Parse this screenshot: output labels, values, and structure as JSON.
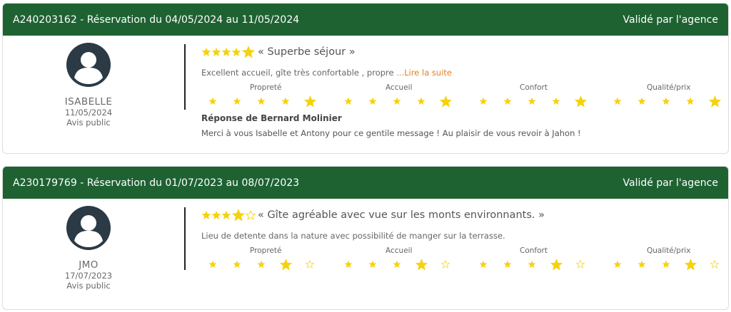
{
  "colors": {
    "header_bg": "#1e6232",
    "star": "#f5d20b",
    "star_empty": "#f5d20b",
    "link": "#e67e22"
  },
  "reviews": [
    {
      "header": {
        "title": "A240203162 - Réservation du 04/05/2024 au 11/05/2024",
        "status": "Validé par l'agence"
      },
      "author": {
        "name": "ISABELLE",
        "date": "11/05/2024",
        "visibility": "Avis public",
        "icon": "user-avatar-icon"
      },
      "rating": 5,
      "title": "« Superbe séjour »",
      "excerpt": "Excellent accueil, gîte très confortable , propre ",
      "read_more": "...Lire la suite",
      "criteria": [
        {
          "label": "Propreté",
          "rating": 5
        },
        {
          "label": "Accueil",
          "rating": 5
        },
        {
          "label": "Confort",
          "rating": 5
        },
        {
          "label": "Qualité/prix",
          "rating": 5
        }
      ],
      "response": {
        "title": "Réponse de Bernard Molinier",
        "text": "Merci à vous Isabelle et Antony pour ce gentile message ! Au plaisir de vous revoir à Jahon !"
      }
    },
    {
      "header": {
        "title": "A230179769 - Réservation du 01/07/2023 au 08/07/2023",
        "status": "Validé par l'agence"
      },
      "author": {
        "name": "JMO",
        "date": "17/07/2023",
        "visibility": "Avis public",
        "icon": "user-avatar-icon"
      },
      "rating": 4,
      "title": "« Gîte agréable avec vue sur les monts environnants. »",
      "excerpt": "Lieu de detente dans la nature avec possibilité de manger sur la terrasse.",
      "read_more": "",
      "criteria": [
        {
          "label": "Propreté",
          "rating": 4
        },
        {
          "label": "Accueil",
          "rating": 4
        },
        {
          "label": "Confort",
          "rating": 4
        },
        {
          "label": "Qualité/prix",
          "rating": 4
        }
      ]
    }
  ]
}
